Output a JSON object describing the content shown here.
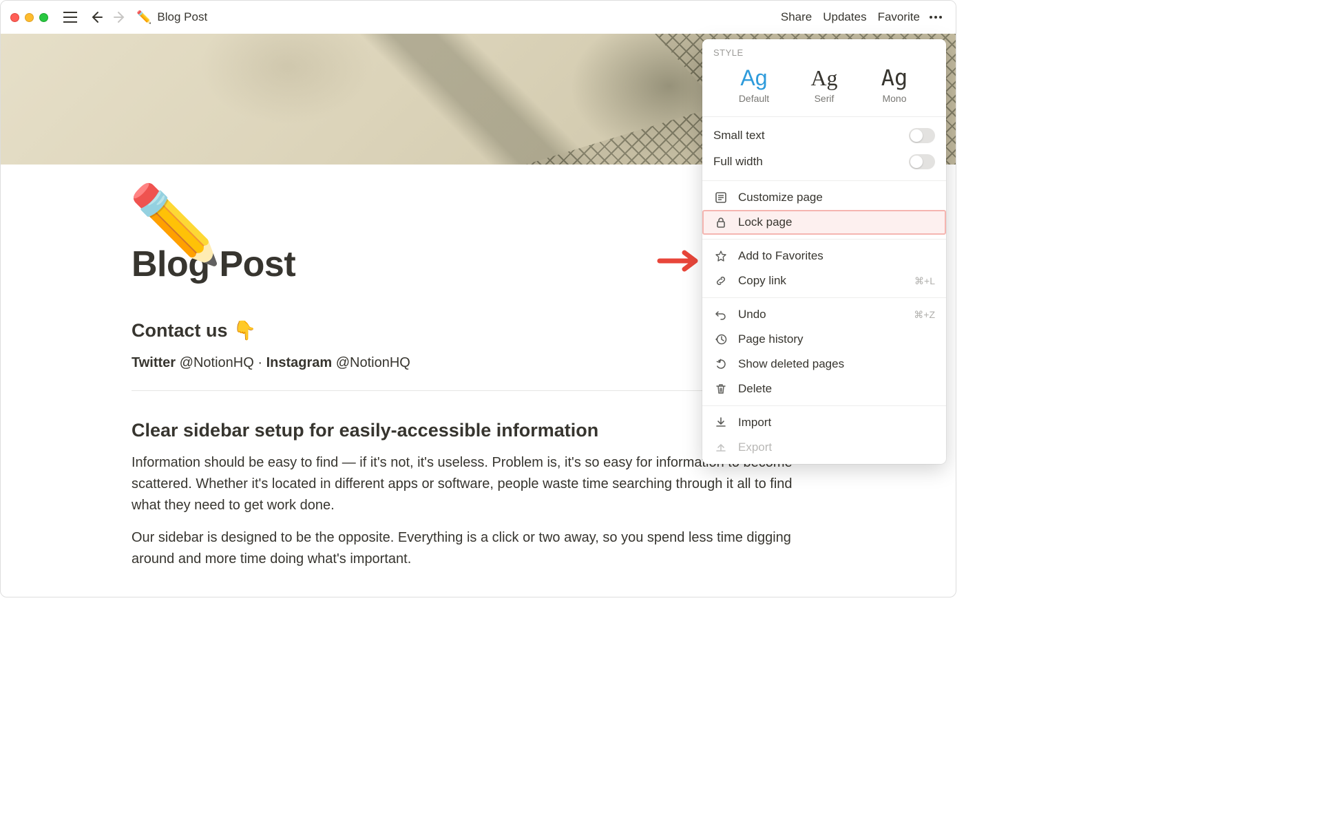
{
  "breadcrumb": {
    "emoji": "✏️",
    "title": "Blog Post"
  },
  "topbar": {
    "share": "Share",
    "updates": "Updates",
    "favorite": "Favorite"
  },
  "page": {
    "icon": "✏️",
    "title": "Blog Post",
    "contact_heading": "Contact us",
    "contact_emoji": "👇",
    "twitter_label": "Twitter",
    "twitter_handle": "@NotionHQ",
    "separator": "·",
    "instagram_label": "Instagram",
    "instagram_handle": "@NotionHQ",
    "section_heading": "Clear sidebar setup for easily-accessible information",
    "para1": "Information should be easy to find — if it's not, it's useless. Problem is, it's so easy for information to become scattered. Whether it's located in different apps or software, people waste time searching through it all to find what they need to get work done.",
    "para2": "Our sidebar is designed to be the opposite. Everything is a click or two away, so you spend less time digging around and more time doing what's important."
  },
  "panel": {
    "style_label": "STYLE",
    "styles": [
      {
        "sample": "Ag",
        "name": "Default",
        "active": true
      },
      {
        "sample": "Ag",
        "name": "Serif",
        "active": false
      },
      {
        "sample": "Ag",
        "name": "Mono",
        "active": false
      }
    ],
    "toggles": {
      "small_text": "Small text",
      "full_width": "Full width"
    },
    "items": {
      "customize": "Customize page",
      "lock": "Lock page",
      "favorites": "Add to Favorites",
      "copy_link": "Copy link",
      "copy_link_shortcut": "⌘+L",
      "undo": "Undo",
      "undo_shortcut": "⌘+Z",
      "history": "Page history",
      "deleted": "Show deleted pages",
      "delete": "Delete",
      "import": "Import",
      "export": "Export"
    }
  }
}
